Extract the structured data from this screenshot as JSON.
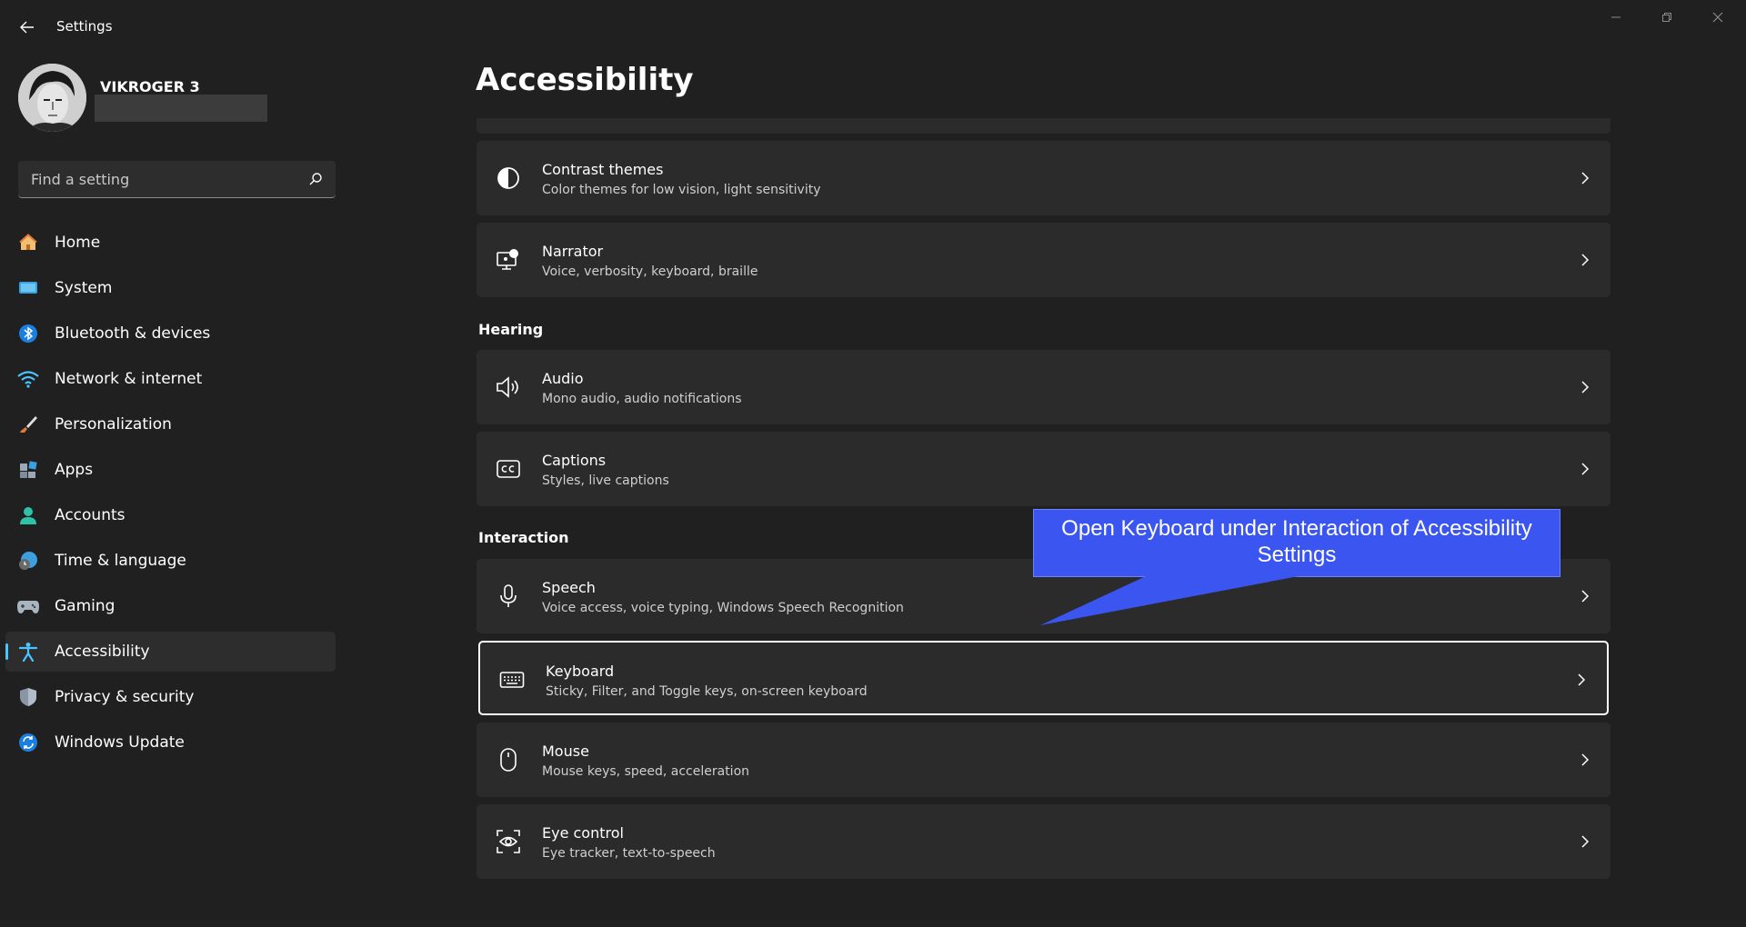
{
  "window": {
    "title": "Settings"
  },
  "profile": {
    "name": "VIKROGER 3"
  },
  "search": {
    "placeholder": "Find a setting"
  },
  "nav": {
    "items": [
      {
        "label": "Home",
        "icon": "home-icon"
      },
      {
        "label": "System",
        "icon": "system-icon"
      },
      {
        "label": "Bluetooth & devices",
        "icon": "bluetooth-icon"
      },
      {
        "label": "Network & internet",
        "icon": "wifi-icon"
      },
      {
        "label": "Personalization",
        "icon": "brush-icon"
      },
      {
        "label": "Apps",
        "icon": "apps-icon"
      },
      {
        "label": "Accounts",
        "icon": "person-icon"
      },
      {
        "label": "Time & language",
        "icon": "globe-clock-icon"
      },
      {
        "label": "Gaming",
        "icon": "gamepad-icon"
      },
      {
        "label": "Accessibility",
        "icon": "accessibility-icon",
        "active": true
      },
      {
        "label": "Privacy & security",
        "icon": "shield-icon"
      },
      {
        "label": "Windows Update",
        "icon": "update-icon"
      }
    ]
  },
  "main": {
    "title": "Accessibility",
    "sections": {
      "hearing": "Hearing",
      "interaction": "Interaction"
    },
    "cards": [
      {
        "title": "Contrast themes",
        "subtitle": "Color themes for low vision, light sensitivity",
        "icon": "contrast-icon"
      },
      {
        "title": "Narrator",
        "subtitle": "Voice, verbosity, keyboard, braille",
        "icon": "narrator-icon"
      },
      {
        "title": "Audio",
        "subtitle": "Mono audio, audio notifications",
        "icon": "speaker-icon"
      },
      {
        "title": "Captions",
        "subtitle": "Styles, live captions",
        "icon": "captions-icon"
      },
      {
        "title": "Speech",
        "subtitle": "Voice access, voice typing, Windows Speech Recognition",
        "icon": "microphone-icon"
      },
      {
        "title": "Keyboard",
        "subtitle": "Sticky, Filter, and Toggle keys, on-screen keyboard",
        "icon": "keyboard-icon",
        "focused": true
      },
      {
        "title": "Mouse",
        "subtitle": "Mouse keys, speed, acceleration",
        "icon": "mouse-icon"
      },
      {
        "title": "Eye control",
        "subtitle": "Eye tracker, text-to-speech",
        "icon": "eye-control-icon"
      }
    ]
  },
  "callout": {
    "text": "Open Keyboard under Interaction of Accessibility Settings"
  },
  "colors": {
    "background": "#202020",
    "card": "#2b2b2b",
    "accent": "#4cc2ff",
    "callout": "#3b55f0"
  }
}
